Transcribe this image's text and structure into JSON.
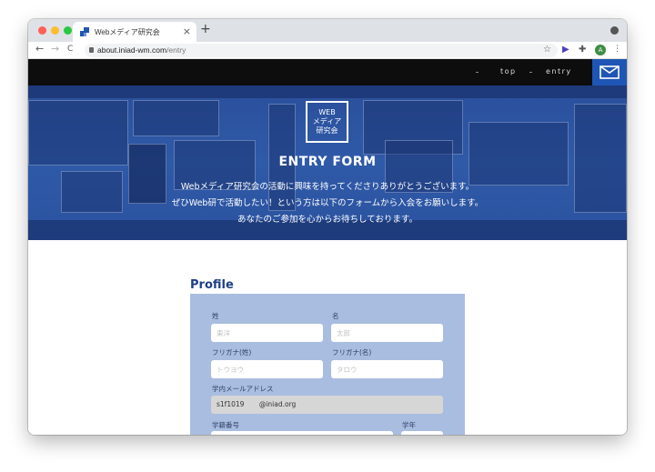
{
  "browser": {
    "tab_title": "Webメディア研究会",
    "tab_close": "×",
    "new_tab": "+",
    "back": "←",
    "forward": "→",
    "reload": "C",
    "url_host": "about.iniad-wm.com",
    "url_path": "/entry",
    "avatar_letter": "A",
    "colors": {
      "close": "#ff5f57",
      "minimize": "#febc2e",
      "maximize": "#28c840"
    }
  },
  "site": {
    "nav": [
      {
        "label": "top"
      },
      {
        "label": "entry"
      }
    ],
    "logo_lines": [
      "WEB",
      "メディア",
      "研究会"
    ],
    "hero_title": "ENTRY FORM",
    "hero_lines": [
      "Webメディア研究会の活動に興味を持ってくださりありがとうございます。",
      "ぜひWeb研で活動したい！という方は以下のフォームから入会をお願いします。",
      "あなたのご参加を心からお待ちしております。"
    ],
    "accent": "#1f56b5"
  },
  "form": {
    "heading": "Profile",
    "last_name_label": "姓",
    "last_name_placeholder": "東洋",
    "first_name_label": "名",
    "first_name_placeholder": "太郎",
    "last_kana_label": "フリガナ(姓)",
    "last_kana_placeholder": "トウヨウ",
    "first_kana_label": "フリガナ(名)",
    "first_kana_placeholder": "タロウ",
    "email_label": "学内メールアドレス",
    "email_prefix": "s1f1019",
    "email_domain": "@iniad.org",
    "student_id_label": "学籍番号",
    "grade_label": "学年"
  }
}
